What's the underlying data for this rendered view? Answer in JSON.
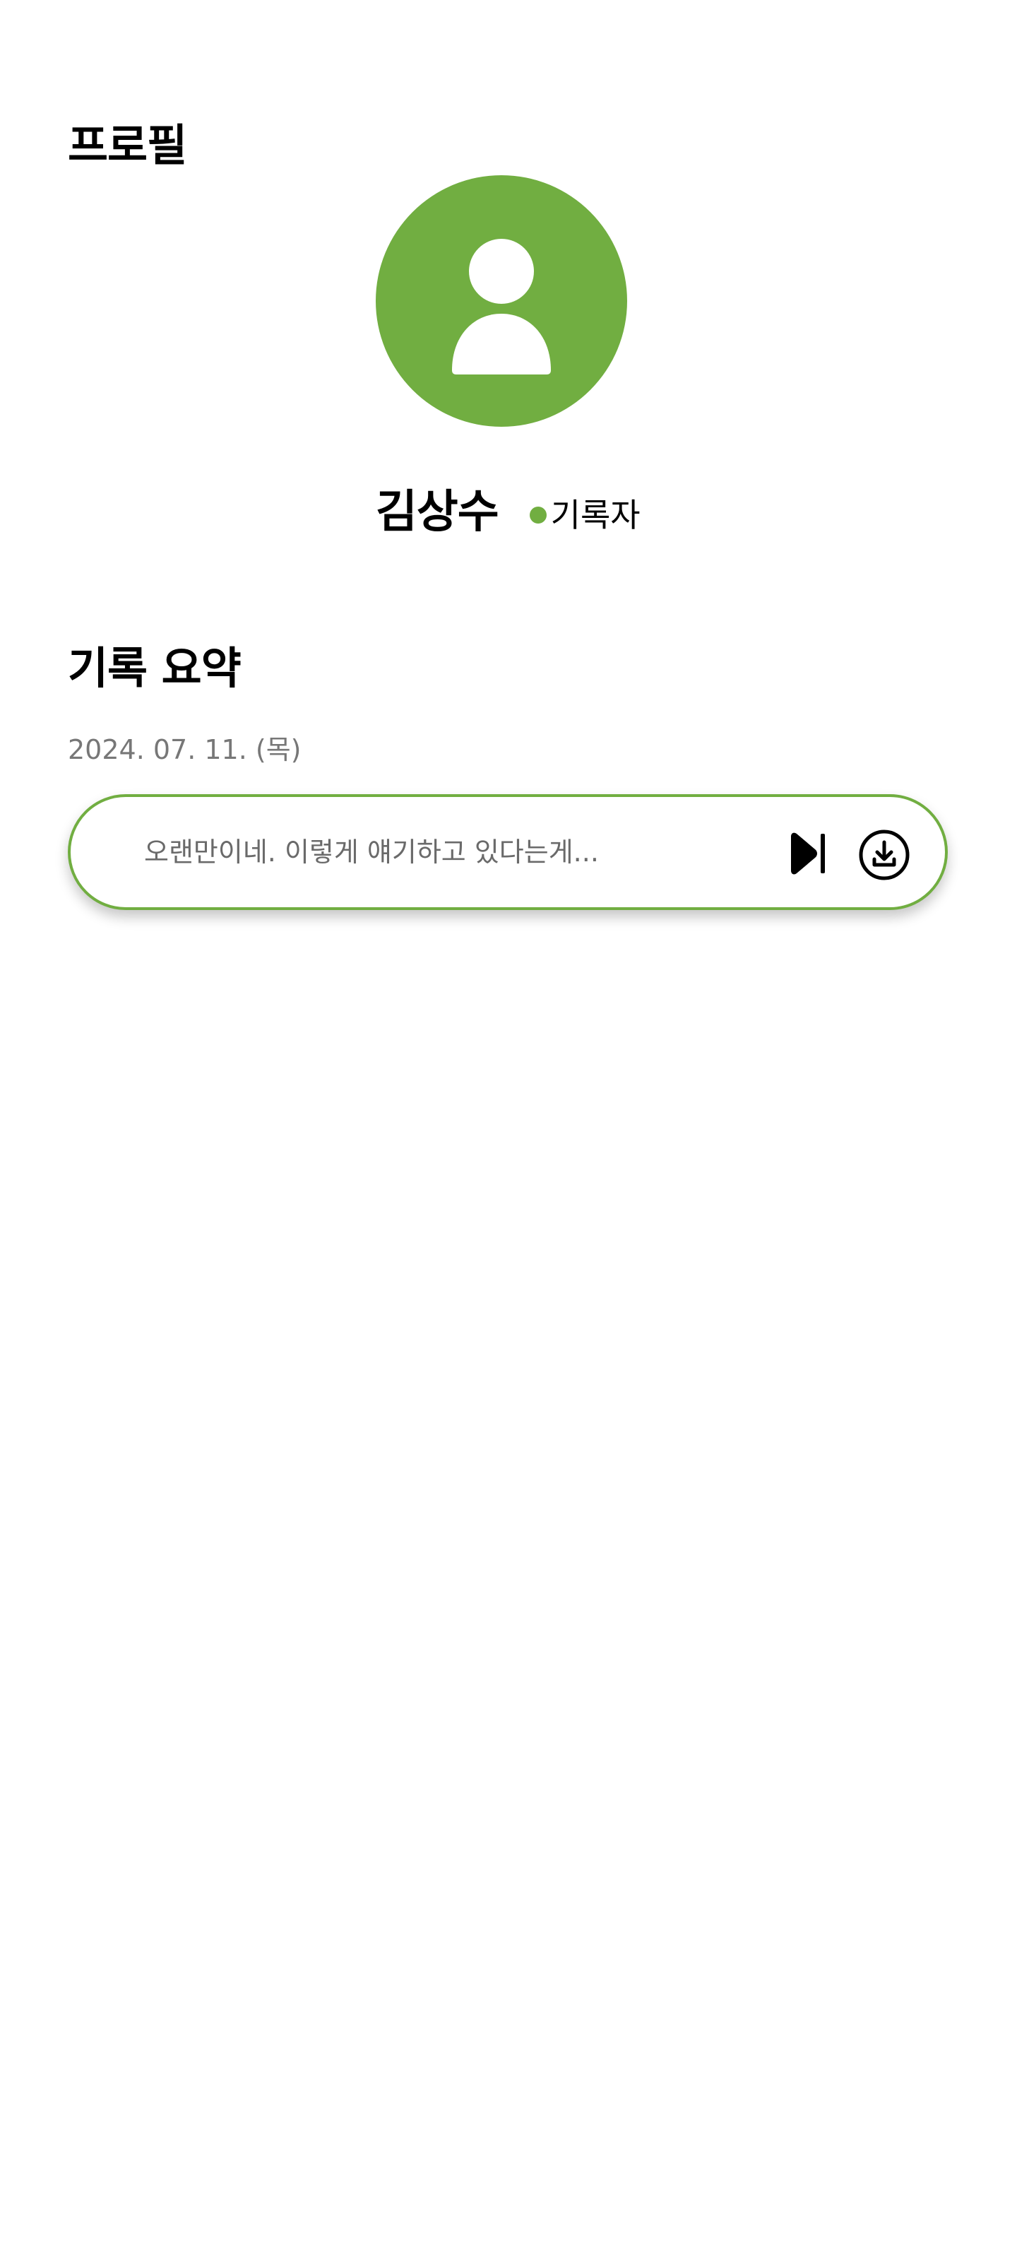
{
  "header": {
    "title": "프로필"
  },
  "profile": {
    "avatar_icon": "user-icon",
    "name": "김상수",
    "role": "기록자",
    "accent_color": "#71ae41"
  },
  "summary": {
    "title": "기록 요약",
    "records": [
      {
        "date": "2024. 07. 11. (목)",
        "preview": "오랜만이네. 이렇게 얘기하고 있다는게...",
        "play_icon": "play-next-icon",
        "download_icon": "download-icon"
      }
    ]
  }
}
